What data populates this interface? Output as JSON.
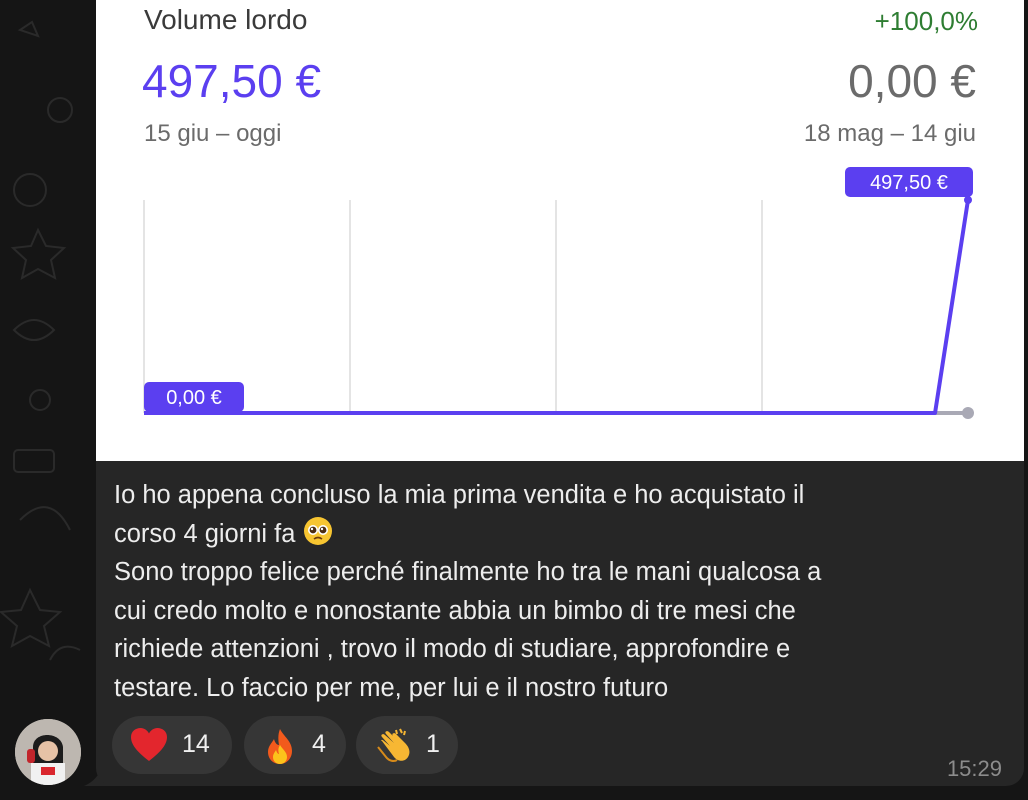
{
  "card": {
    "title": "Volume lordo",
    "change_pct": "+100,0%",
    "current_value": "497,50 €",
    "previous_value": "0,00 €",
    "current_range": "15 giu – oggi",
    "previous_range": "18 mag – 14 giu",
    "colors": {
      "accent": "#5b3ff0",
      "positive": "#2e7d32"
    }
  },
  "chart_data": {
    "type": "line",
    "series": [
      {
        "values": [
          0,
          0,
          0,
          0,
          0,
          497.5
        ]
      }
    ],
    "comparison_series": [
      {
        "values": [
          0,
          0,
          0,
          0,
          0,
          0
        ]
      }
    ],
    "x_position_fraction": [
      0,
      0.25,
      0.5,
      0.75,
      0.96,
      1.0
    ],
    "annotations": [
      "0,00 €",
      "497,50 €"
    ],
    "ylim": [
      0,
      497.5
    ],
    "grid": true
  },
  "message": {
    "lines": [
      "Io ho appena concluso la mia prima vendita e ho acquistato il",
      "corso 4 giorni fa",
      "Sono troppo felice perché finalmente ho tra le mani qualcosa a",
      "cui credo molto e nonostante abbia un bimbo di tre mesi che",
      "richiede attenzioni , trovo il modo di studiare, approfondire e",
      "testare. Lo faccio per me, per lui e il nostro futuro"
    ],
    "emoji_after_line2": "pleading-face-icon"
  },
  "reactions": [
    {
      "icon": "heart-icon",
      "count": "14"
    },
    {
      "icon": "fire-icon",
      "count": "4"
    },
    {
      "icon": "clapping-hands-icon",
      "count": "1"
    }
  ],
  "timestamp": "15:29"
}
